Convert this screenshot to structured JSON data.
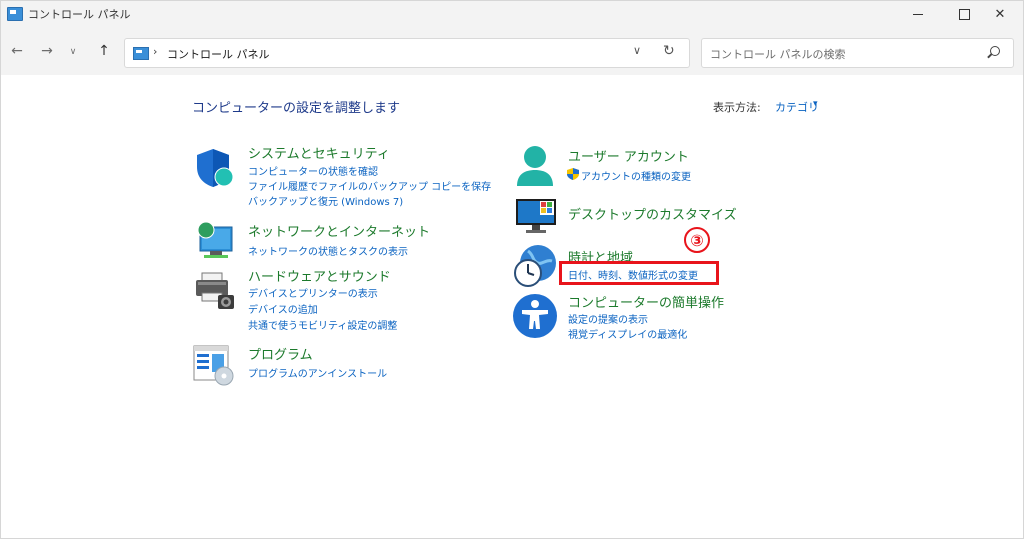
{
  "window": {
    "title": "コントロール パネル"
  },
  "nav": {
    "back_glyph": "←",
    "forward_glyph": "→",
    "recent_glyph": "∨",
    "up_glyph": "↑",
    "address_separator": "›",
    "address_path": "コントロール パネル",
    "dropdown_glyph": "∨",
    "refresh_glyph": "↻",
    "search_placeholder": "コントロール パネルの検索"
  },
  "content": {
    "heading": "コンピューターの設定を調整します",
    "view_by_label": "表示方法:",
    "view_by_value": "カテゴリ",
    "view_by_caret": "▾"
  },
  "categories": {
    "system_security": {
      "title": "システムとセキュリティ",
      "links": [
        "コンピューターの状態を確認",
        "ファイル履歴でファイルのバックアップ コピーを保存",
        "バックアップと復元 (Windows 7)"
      ]
    },
    "network": {
      "title": "ネットワークとインターネット",
      "links": [
        "ネットワークの状態とタスクの表示"
      ]
    },
    "hardware": {
      "title": "ハードウェアとサウンド",
      "links": [
        "デバイスとプリンターの表示",
        "デバイスの追加",
        "共通で使うモビリティ設定の調整"
      ]
    },
    "programs": {
      "title": "プログラム",
      "links": [
        "プログラムのアンインストール"
      ]
    },
    "user_accounts": {
      "title": "ユーザー アカウント",
      "links": [
        "アカウントの種類の変更"
      ]
    },
    "appearance": {
      "title": "デスクトップのカスタマイズ",
      "links": []
    },
    "clock_region": {
      "title": "時計と地域",
      "links": [
        "日付、時刻、数値形式の変更"
      ]
    },
    "ease_of_access": {
      "title": "コンピューターの簡単操作",
      "links": [
        "設定の提案の表示",
        "視覚ディスプレイの最適化"
      ]
    }
  },
  "annotation": {
    "step_label": "③",
    "color": "#e8141b"
  },
  "colors": {
    "category_title": "#1c7a2c",
    "link": "#0b63c1",
    "heading": "#1e3a8a",
    "chrome": "#f3f3f3"
  }
}
